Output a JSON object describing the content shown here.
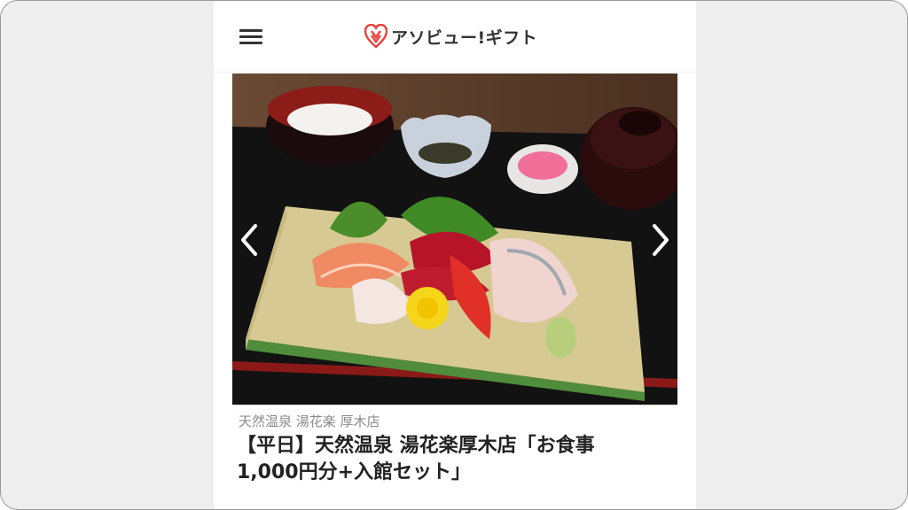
{
  "header": {
    "menu_icon": "hamburger-icon",
    "logo_icon": "heart-logo-icon",
    "logo_text": "アソビュー!ギフト",
    "brand_color": "#e9443d"
  },
  "gallery": {
    "prev_icon": "chevron-left-icon",
    "next_icon": "chevron-right-icon"
  },
  "product": {
    "store_name": "天然温泉 湯花楽 厚木店",
    "title_line1": "【平日】天然温泉 湯花楽厚木店「お食事",
    "title_line2": "1,000円分+入館セット」"
  }
}
